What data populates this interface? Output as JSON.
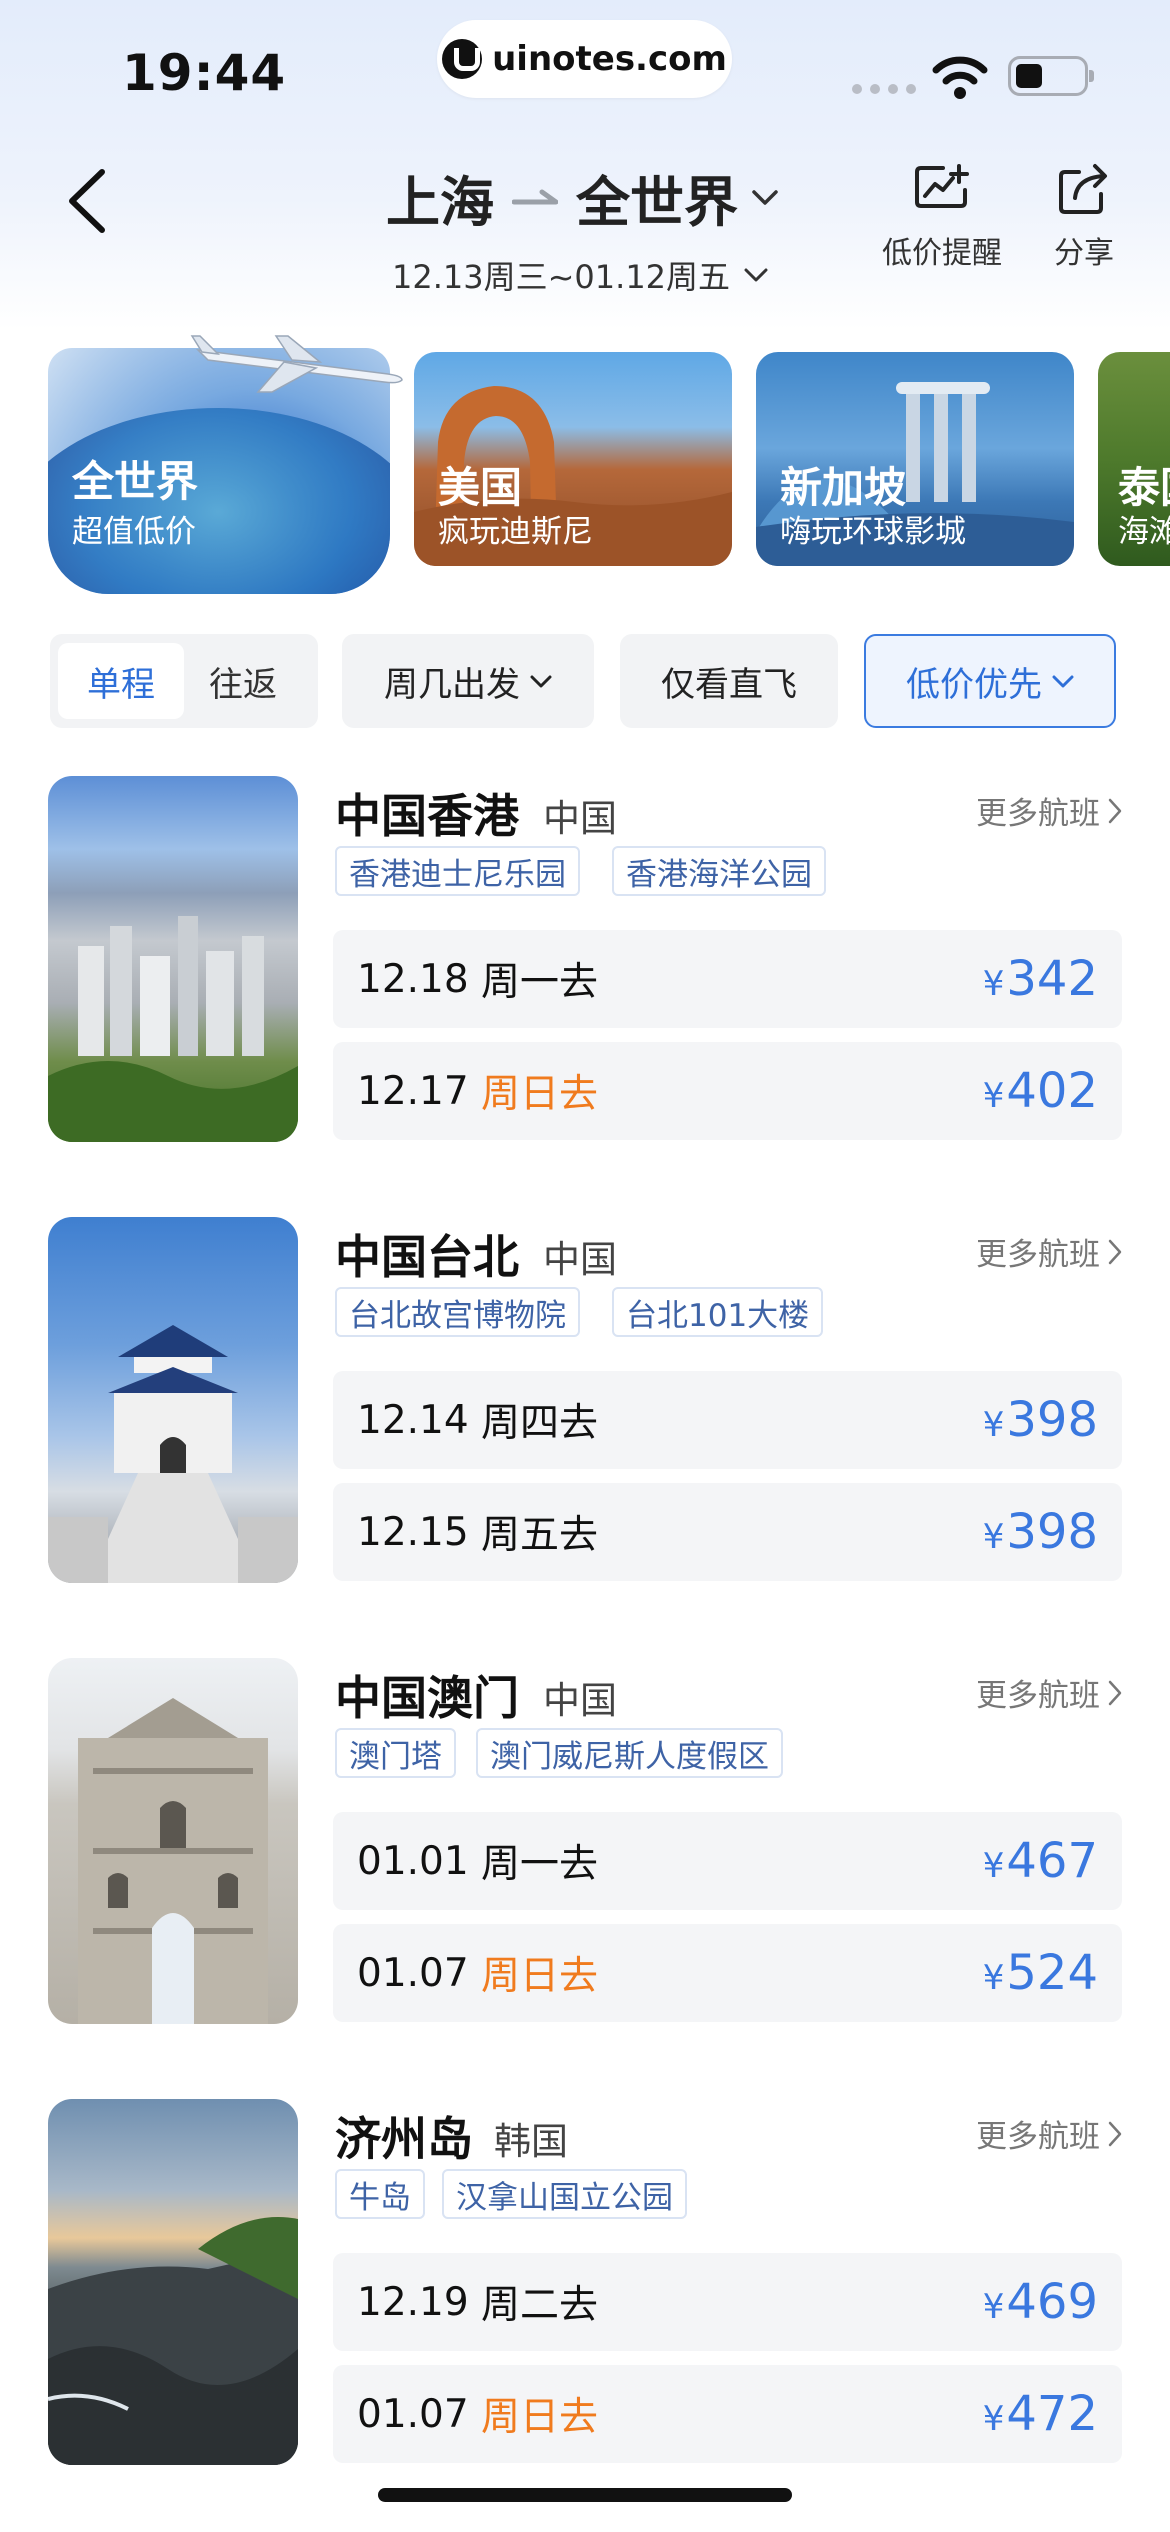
{
  "status_bar": {
    "time": "19:44",
    "url": "uinotes.com"
  },
  "header": {
    "from": "上海",
    "to": "全世界",
    "dates": "12.13周三~01.12周五",
    "price_alert_label": "低价提醒",
    "share_label": "分享"
  },
  "destination_cards": [
    {
      "title": "全世界",
      "subtitle": "超值低价"
    },
    {
      "title": "美国",
      "subtitle": "疯玩迪斯尼"
    },
    {
      "title": "新加坡",
      "subtitle": "嗨玩环球影城"
    },
    {
      "title": "泰国",
      "subtitle": "海滩"
    }
  ],
  "filters": {
    "one_way": "单程",
    "round_trip": "往返",
    "weekday": "周几出发",
    "direct_only": "仅看直飞",
    "sort": "低价优先"
  },
  "more_flights_label": "更多航班",
  "results": [
    {
      "name": "中国香港",
      "country": "中国",
      "tags": [
        "香港迪士尼乐园",
        "香港海洋公园"
      ],
      "flights": [
        {
          "date": "12.18",
          "weekday": "周一去",
          "price": "342",
          "currency": "¥",
          "sunday": false
        },
        {
          "date": "12.17",
          "weekday": "周日去",
          "price": "402",
          "currency": "¥",
          "sunday": true
        }
      ]
    },
    {
      "name": "中国台北",
      "country": "中国",
      "tags": [
        "台北故宫博物院",
        "台北101大楼"
      ],
      "flights": [
        {
          "date": "12.14",
          "weekday": "周四去",
          "price": "398",
          "currency": "¥",
          "sunday": false
        },
        {
          "date": "12.15",
          "weekday": "周五去",
          "price": "398",
          "currency": "¥",
          "sunday": false
        }
      ]
    },
    {
      "name": "中国澳门",
      "country": "中国",
      "tags": [
        "澳门塔",
        "澳门威尼斯人度假区"
      ],
      "flights": [
        {
          "date": "01.01",
          "weekday": "周一去",
          "price": "467",
          "currency": "¥",
          "sunday": false
        },
        {
          "date": "01.07",
          "weekday": "周日去",
          "price": "524",
          "currency": "¥",
          "sunday": true
        }
      ]
    },
    {
      "name": "济州岛",
      "country": "韩国",
      "tags": [
        "牛岛",
        "汉拿山国立公园"
      ],
      "flights": [
        {
          "date": "12.19",
          "weekday": "周二去",
          "price": "469",
          "currency": "¥",
          "sunday": false
        },
        {
          "date": "01.07",
          "weekday": "周日去",
          "price": "472",
          "currency": "¥",
          "sunday": true
        }
      ]
    }
  ],
  "colors": {
    "accent": "#3a78df",
    "sunday": "#f07b1e",
    "tag_text": "#3e63a6"
  }
}
